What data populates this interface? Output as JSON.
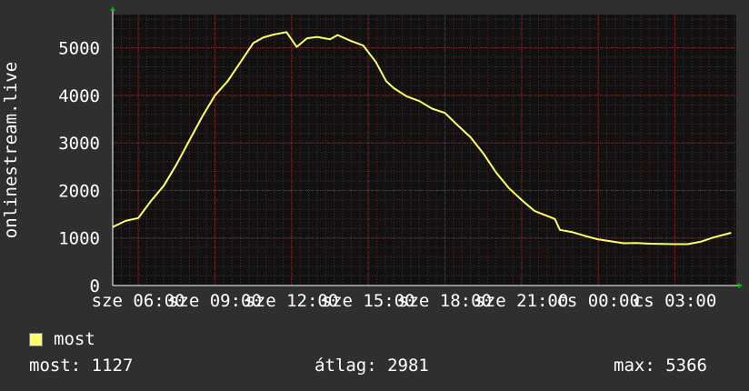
{
  "chart_data": {
    "type": "line",
    "title": "",
    "ylabel": "onlinestream.live",
    "xlabel": "",
    "ylim": [
      0,
      5700
    ],
    "yticks": [
      0,
      1000,
      2000,
      3000,
      4000,
      5000
    ],
    "xlim": [
      0,
      24.4
    ],
    "xticks": [
      {
        "x": 1,
        "label": "sze 06:00"
      },
      {
        "x": 4,
        "label": "sze 09:00"
      },
      {
        "x": 7,
        "label": "sze 12:00"
      },
      {
        "x": 10,
        "label": "sze 15:00"
      },
      {
        "x": 13,
        "label": "sze 18:00"
      },
      {
        "x": 16,
        "label": "sze 21:00"
      },
      {
        "x": 19,
        "label": "cs 00:00"
      },
      {
        "x": 22,
        "label": "cs 03:00"
      }
    ],
    "grid": true,
    "series": [
      {
        "name": "most",
        "color": "#ffff66",
        "x": [
          0,
          0.5,
          1,
          1.5,
          2,
          2.5,
          3,
          3.5,
          4,
          4.5,
          5,
          5.5,
          5.9,
          6.3,
          6.8,
          7.2,
          7.6,
          8,
          8.5,
          8.8,
          9.3,
          9.8,
          10.3,
          10.7,
          11,
          11.5,
          12,
          12.5,
          13,
          13.5,
          14,
          14.5,
          15,
          15.5,
          16,
          16.5,
          17.3,
          17.5,
          18,
          18.5,
          19,
          19.5,
          20,
          20.5,
          21,
          21.5,
          22,
          22.5,
          23,
          23.5,
          24.2
        ],
        "y": [
          1230,
          1360,
          1420,
          1780,
          2100,
          2550,
          3050,
          3550,
          4000,
          4300,
          4700,
          5100,
          5220,
          5280,
          5330,
          5020,
          5200,
          5230,
          5180,
          5270,
          5150,
          5050,
          4700,
          4300,
          4150,
          3980,
          3880,
          3720,
          3630,
          3370,
          3120,
          2780,
          2380,
          2050,
          1800,
          1570,
          1400,
          1170,
          1120,
          1040,
          970,
          930,
          890,
          895,
          880,
          875,
          870,
          870,
          920,
          1010,
          1110
        ]
      }
    ]
  },
  "legend": {
    "swatch_color": "#ffff66",
    "label": "most"
  },
  "stats": {
    "now": "most: 1127",
    "avg": "átlag: 2981",
    "max": "max: 5366"
  },
  "colors": {
    "background": "#2f2f2f",
    "plot_background": "#111111",
    "grid_minor": "#5a2a2a",
    "grid_major": "#7a3030",
    "axis": "#ffffff",
    "arrow": "#00c000"
  }
}
